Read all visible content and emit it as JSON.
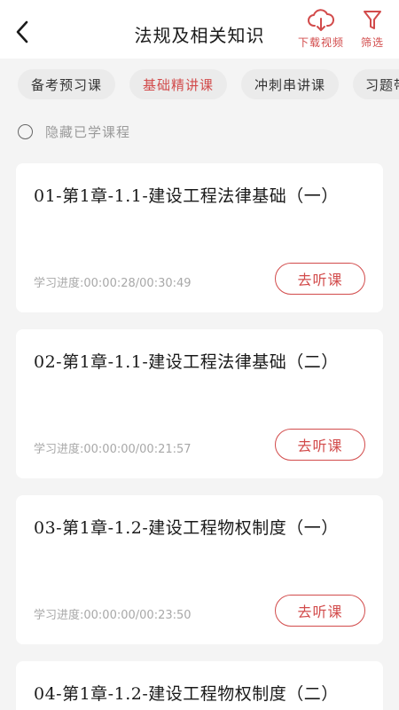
{
  "header": {
    "title": "法规及相关知识",
    "back_icon": "chevron-left-icon",
    "download_label": "下载视频",
    "download_icon": "cloud-download-icon",
    "filter_label": "筛选",
    "filter_icon": "funnel-icon",
    "accent_color": "#d24b4b"
  },
  "tabs": [
    {
      "label": "备考预习课",
      "active": false
    },
    {
      "label": "基础精讲课",
      "active": true
    },
    {
      "label": "冲刺串讲课",
      "active": false
    },
    {
      "label": "习题带",
      "active": false
    }
  ],
  "hide_learned": {
    "label": "隐藏已学课程",
    "checked": false
  },
  "courses": [
    {
      "title": "01-第1章-1.1-建设工程法律基础（一）",
      "progress": "学习进度:00:00:28/00:30:49",
      "button": "去听课"
    },
    {
      "title": "02-第1章-1.1-建设工程法律基础（二）",
      "progress": "学习进度:00:00:00/00:21:57",
      "button": "去听课"
    },
    {
      "title": "03-第1章-1.2-建设工程物权制度（一）",
      "progress": "学习进度:00:00:00/00:23:50",
      "button": "去听课"
    },
    {
      "title": "04-第1章-1.2-建设工程物权制度（二）",
      "progress": "",
      "button": ""
    }
  ]
}
